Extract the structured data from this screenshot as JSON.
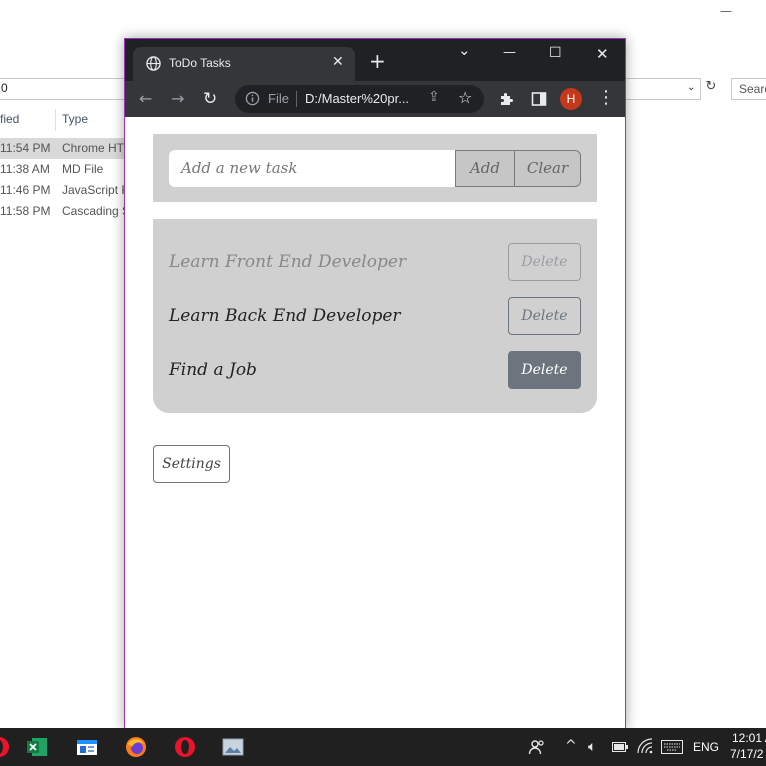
{
  "background_window": {
    "controls": {
      "minimize": "—",
      "maximize": "☐"
    },
    "address_text": "0",
    "search_placeholder": "Searc",
    "columns": {
      "modified": "fied",
      "type": "Type"
    },
    "rows": [
      {
        "time": "11:54 PM",
        "type": "Chrome HT",
        "selected": true
      },
      {
        "time": "11:38 AM",
        "type": "MD File",
        "selected": false
      },
      {
        "time": "11:46 PM",
        "type": "JavaScript F",
        "selected": false
      },
      {
        "time": "11:58 PM",
        "type": "Cascading S",
        "selected": false
      }
    ]
  },
  "browser": {
    "tab": {
      "title": "ToDo Tasks",
      "close": "✕",
      "favicon": "globe-icon"
    },
    "new_tab": "+",
    "window_controls": {
      "tab_search": "⌄",
      "minimize": "—",
      "maximize": "☐",
      "close": "✕"
    },
    "toolbar": {
      "back": "←",
      "forward": "→",
      "reload": "↻",
      "scheme": "File",
      "url": "D:/Master%20pr...",
      "share": "⇪",
      "bookmark": "☆",
      "extensions": "puzzle-icon",
      "side_panel": "side-panel-icon",
      "profile_initial": "H",
      "menu": "⋮"
    },
    "colors": {
      "frame": "#202124",
      "toolbar": "#35363a",
      "avatar": "#c5381b",
      "border": "#9b34b8"
    }
  },
  "app": {
    "input": {
      "placeholder": "Add a new task"
    },
    "add_label": "Add",
    "clear_label": "Clear",
    "tasks": [
      {
        "text": "Learn Front End Developer",
        "completed": true,
        "delete_label": "Delete",
        "delete_state": "disabled"
      },
      {
        "text": "Learn Back End Developer",
        "completed": false,
        "delete_label": "Delete",
        "delete_state": "normal"
      },
      {
        "text": "Find a Job",
        "completed": false,
        "delete_label": "Delete",
        "delete_state": "hover"
      }
    ],
    "settings_label": "Settings",
    "colors": {
      "panel": "#d0d0d0",
      "button": "#6c757d"
    }
  },
  "taskbar": {
    "apps": [
      "opera-icon",
      "excel-icon",
      "file-explorer-icon",
      "firefox-icon",
      "opera-icon",
      "photo-app-icon"
    ],
    "tray": {
      "people": "people-icon",
      "overflow": "^",
      "volume": "speaker-icon",
      "battery": "battery-icon",
      "wifi": "wifi-icon",
      "keyboard": "keyboard-icon",
      "language": "ENG",
      "time": "12:01 A",
      "date": "7/17/2"
    }
  }
}
